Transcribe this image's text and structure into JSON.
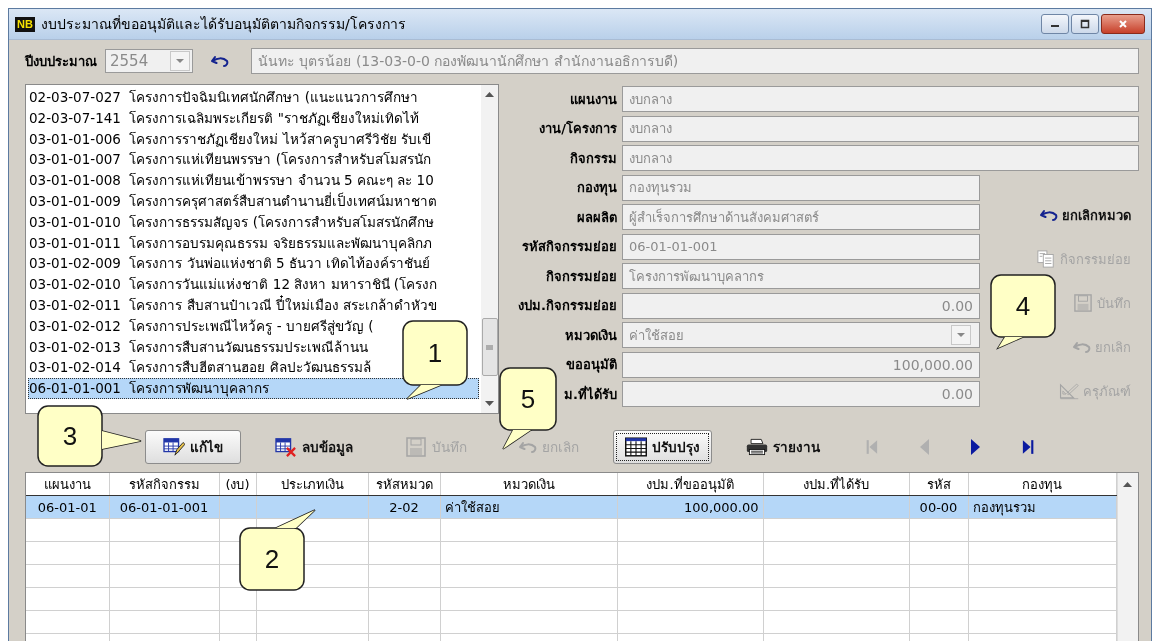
{
  "window": {
    "app_icon": "NB",
    "title": "งบประมาณที่ขออนุมัติและได้รับอนุมัติตามกิจกรรม/โครงการ"
  },
  "window_controls": [
    {
      "kind": "minimize"
    },
    {
      "kind": "maximize"
    },
    {
      "kind": "close"
    }
  ],
  "header": {
    "year_label": "ปีงบประมาณ",
    "year": "2554",
    "year_disabled": true,
    "person": "นันทะ บุตรน้อย  (13-03-0-0 กองพัฒนานักศึกษา สำนักงานอธิการบดี)"
  },
  "project_list": {
    "items": [
      {
        "code": "02-03-07-027",
        "name": "โครงการปัจฉิมนิเทศนักศึกษา (แนะแนวการศึกษา",
        "selected": false
      },
      {
        "code": "02-03-07-141",
        "name": "โครงการเฉลิมพระเกียรติ \"ราชภัฏเชียงใหม่เทิดไท้",
        "selected": false
      },
      {
        "code": "03-01-01-006",
        "name": "โครงการราชภัฏเชียงใหม่ ไหว้สาครูบาศรีวิชัย รับเขี",
        "selected": false
      },
      {
        "code": "03-01-01-007",
        "name": "โครงการแห่เทียนพรรษา (โครงการสำหรับสโมสรนัก",
        "selected": false
      },
      {
        "code": "03-01-01-008",
        "name": "โครงการแห่เทียนเข้าพรรษา จำนวน 5 คณะๆ ละ 10",
        "selected": false
      },
      {
        "code": "03-01-01-009",
        "name": "โครงการครุศาสตร์สืบสานตำนานยี่เป็งเทศน์มหาชาต",
        "selected": false
      },
      {
        "code": "03-01-01-010",
        "name": "โครงการธรรมสัญจร (โครงการสำหรับสโมสรนักศึกษ",
        "selected": false
      },
      {
        "code": "03-01-01-011",
        "name": "โครงการอบรมคุณธรรม จริยธรรมและพัฒนาบุคลิกภ",
        "selected": false
      },
      {
        "code": "03-01-02-009",
        "name": "โครงการ วันพ่อแห่งชาติ 5 ธันวา เทิดไท้องค์ราชันย์",
        "selected": false
      },
      {
        "code": "03-01-02-010",
        "name": "โครงการวันแม่แห่งชาติ 12 สิงหา มหาราชินี (โครงก",
        "selected": false
      },
      {
        "code": "03-01-02-011",
        "name": "โครงการ สืบสานป๋าเวณี ปี๋ใหม่เมือง สระเกล้าดำหัวข",
        "selected": false
      },
      {
        "code": "03-01-02-012",
        "name": "โครงการประเพณีไหว้ครู - บายศรีสู่ขวัญ (",
        "selected": false
      },
      {
        "code": "03-01-02-013",
        "name": "โครงการสืบสานวัฒนธรรมประเพณีล้านน",
        "selected": false
      },
      {
        "code": "03-01-02-014",
        "name": "โครงการสืบฮีตสานฮอย ศิลปะวัฒนธรรมล้",
        "selected": false
      },
      {
        "code": "06-01-01-001",
        "name": "โครงการพัฒนาบุคลากร",
        "selected": true
      }
    ]
  },
  "form": {
    "top_fields": [
      {
        "label": "แผนงาน",
        "value": "งบกลาง",
        "kind": "text"
      },
      {
        "label": "งาน/โครงการ",
        "value": "งบกลาง",
        "kind": "text"
      },
      {
        "label": "กิจกรรม",
        "value": "งบกลาง",
        "kind": "text"
      }
    ],
    "fields": [
      {
        "label": "กองทุน",
        "value": "กองทุนรวม",
        "kind": "text"
      },
      {
        "label": "ผลผลิต",
        "value": "ผู้สำเร็จการศึกษาด้านสังคมศาสตร์",
        "kind": "text"
      },
      {
        "label": "รหัสกิจกรรมย่อย",
        "value": "06-01-01-001",
        "kind": "text"
      },
      {
        "label": "กิจกรรมย่อย",
        "value": "โครงการพัฒนาบุคลากร",
        "kind": "text"
      },
      {
        "label": "งปม.กิจกรรมย่อย",
        "value": "0.00",
        "kind": "number"
      },
      {
        "label": "หมวดเงิน",
        "value": "ค่าใช้สอย",
        "kind": "combo"
      },
      {
        "label": "ขออนุมัติ",
        "value": "100,000.00",
        "kind": "number"
      },
      {
        "label": "ม.ที่ได้รับ",
        "value": "0.00",
        "kind": "number"
      }
    ]
  },
  "side_buttons": [
    {
      "kind": "undo",
      "label": "ยกเลิกหมวด",
      "disabled": false
    },
    {
      "kind": "copy",
      "label": "กิจกรรมย่อย",
      "disabled": true
    },
    {
      "kind": "save",
      "label": "บันทึก",
      "disabled": true
    },
    {
      "kind": "undo",
      "label": "ยกเลิก",
      "disabled": true
    },
    {
      "kind": "setsquare",
      "label": "ครุภัณฑ์",
      "disabled": true
    }
  ],
  "toolbar": [
    {
      "kind": "edit",
      "label": "แก้ไข",
      "disabled": false,
      "raised": true,
      "focused": false
    },
    {
      "kind": "delete",
      "label": "ลบข้อมูล",
      "disabled": false,
      "raised": false,
      "focused": false
    },
    {
      "kind": "save",
      "label": "บันทึก",
      "disabled": true,
      "raised": false,
      "focused": false
    },
    {
      "kind": "undo",
      "label": "ยกเลิก",
      "disabled": true,
      "raised": false,
      "focused": false
    },
    {
      "kind": "grid",
      "label": "ปรับปรุง",
      "disabled": false,
      "raised": true,
      "focused": true
    },
    {
      "kind": "print",
      "label": "รายงาน",
      "disabled": false,
      "raised": false,
      "focused": false
    },
    {
      "kind": "first",
      "disabled": true
    },
    {
      "kind": "prev",
      "disabled": true
    },
    {
      "kind": "next",
      "disabled": false
    },
    {
      "kind": "last",
      "disabled": false
    }
  ],
  "table": {
    "columns": [
      "แผนงาน",
      "รหัสกิจกรรม",
      "(งบ)",
      "ประเภทเงิน",
      "รหัสหมวด",
      "หมวดเงิน",
      "งปม.ที่ขออนุมัติ",
      "งปม.ที่ได้รับ",
      "รหัส",
      "กองทุน"
    ],
    "rows": [
      {
        "cells": [
          "06-01-01",
          "06-01-01-001",
          "",
          "",
          "2-02",
          "ค่าใช้สอย",
          "100,000.00",
          "",
          "00-00",
          "กองทุนรวม"
        ],
        "selected": true
      }
    ]
  },
  "callouts": [
    {
      "label": "1"
    },
    {
      "label": "2"
    },
    {
      "label": "3"
    },
    {
      "label": "4"
    },
    {
      "label": "5"
    }
  ]
}
